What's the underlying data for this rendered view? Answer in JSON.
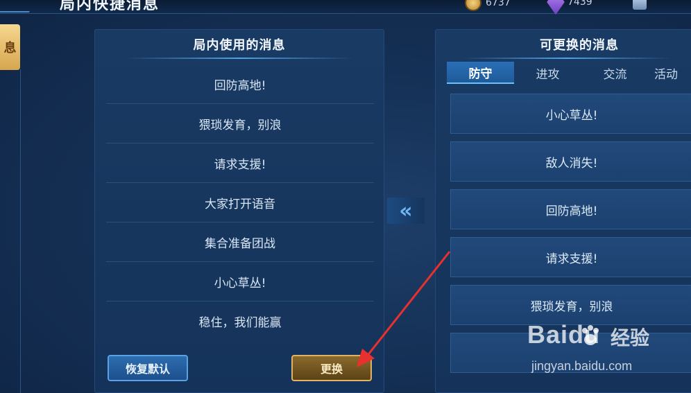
{
  "header": {
    "title": "局内快捷消息",
    "currencies": [
      {
        "icon": "gold-coin-icon",
        "value": "6737"
      },
      {
        "icon": "purple-gem-icon",
        "value": "7439"
      },
      {
        "icon": "crystal-icon",
        "value": ""
      }
    ]
  },
  "side_tab": {
    "label": "息"
  },
  "used_panel": {
    "title": "局内使用的消息",
    "messages": [
      "回防高地!",
      "猥琐发育，别浪",
      "请求支援!",
      "大家打开语音",
      "集合准备团战",
      "小心草丛!",
      "稳住，我们能赢"
    ]
  },
  "buttons": {
    "reset": "恢复默认",
    "swap": "更换",
    "move": "«"
  },
  "available_panel": {
    "title": "可更换的消息",
    "tabs": [
      "防守",
      "进攻",
      "交流",
      "活动"
    ],
    "active_tab": "防守",
    "options": [
      "小心草丛!",
      "敌人消失!",
      "回防高地!",
      "请求支援!",
      "猥琐发育，别浪",
      ""
    ]
  },
  "watermark": {
    "brand": "Baidu",
    "cn": "经验",
    "url": "jingyan.baidu.com"
  },
  "colors": {
    "accent_blue": "#4fa3e6",
    "gold": "#e0b463",
    "annotation_red": "#e8312f"
  }
}
